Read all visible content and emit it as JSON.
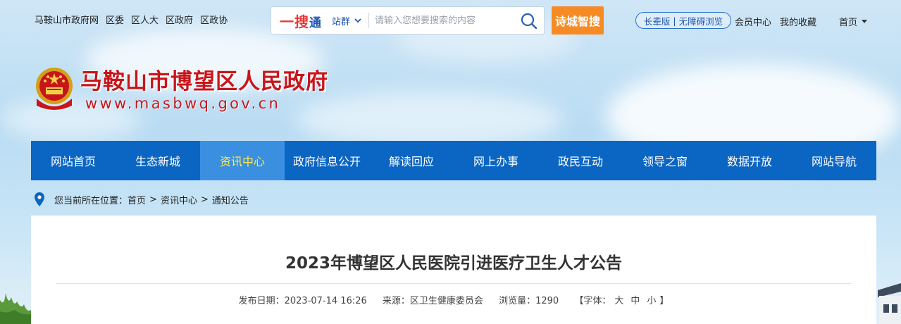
{
  "top_links": [
    "马鞍山市政府网",
    "区委",
    "区人大",
    "区政府",
    "区政协"
  ],
  "search": {
    "logo_main": "一搜",
    "logo_sub": "通",
    "scope": "站群",
    "placeholder": "请输入您想要搜索的内容"
  },
  "smart_search": "诗城智搜",
  "accessibility": {
    "elder": "长辈版",
    "barrier_free": "无障碍浏览"
  },
  "user_links": {
    "member": "会员中心",
    "favorites": "我的收藏",
    "home": "首页"
  },
  "site": {
    "title": "马鞍山市博望区人民政府",
    "url": "www.masbwq.gov.cn"
  },
  "nav": {
    "items": [
      "网站首页",
      "生态新城",
      "资讯中心",
      "政府信息公开",
      "解读回应",
      "网上办事",
      "政民互动",
      "领导之窗",
      "数据开放",
      "网站导航"
    ],
    "active_index": 2
  },
  "breadcrumb": {
    "prefix": "您当前所在位置：",
    "items": [
      "首页",
      "资讯中心",
      "通知公告"
    ]
  },
  "article": {
    "title": "2023年博望区人民医院引进医疗卫生人才公告",
    "publish_label": "发布日期：",
    "publish_date": "2023-07-14 16:26",
    "source_label": "来源：",
    "source": "区卫生健康委员会",
    "views_label": "浏览量：",
    "views": "1290",
    "font_label": "【字体：",
    "font_large": "大",
    "font_medium": "中",
    "font_small": "小",
    "font_close": "】"
  },
  "colors": {
    "nav_bg": "#0b65c2",
    "nav_active_bg": "#3b8fe0",
    "nav_active_text": "#ffe84d",
    "site_title": "#c8151b",
    "smart_search_bg": "#f68b26"
  }
}
